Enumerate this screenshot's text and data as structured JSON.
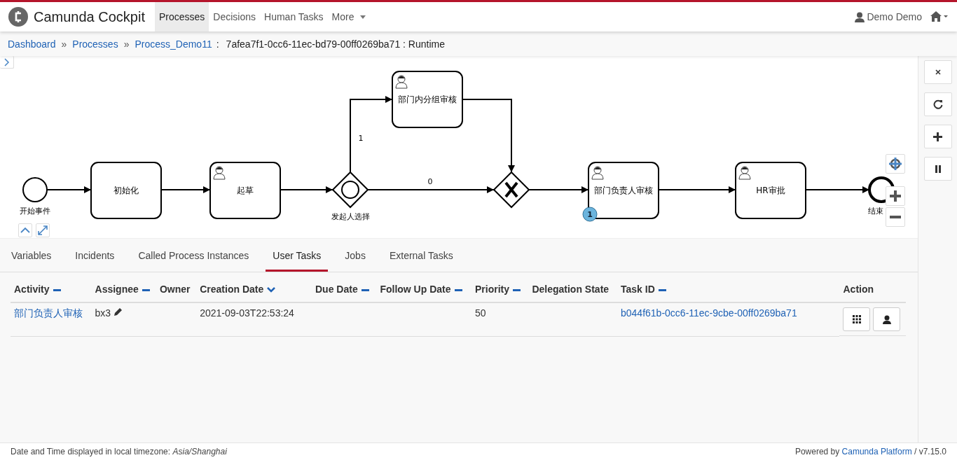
{
  "header": {
    "brand": "Camunda Cockpit",
    "nav": [
      {
        "label": "Processes",
        "selected": true,
        "dropdown": false
      },
      {
        "label": "Decisions",
        "selected": false,
        "dropdown": false
      },
      {
        "label": "Human Tasks",
        "selected": false,
        "dropdown": false
      },
      {
        "label": "More",
        "selected": false,
        "dropdown": true
      }
    ],
    "user": "Demo Demo"
  },
  "breadcrumb": {
    "links": [
      "Dashboard",
      "Processes",
      "Process_Demo11"
    ],
    "separator": "»",
    "current_separator": ":",
    "current": "7afea7f1-0cc6-11ec-bd79-00ff0269ba71 : Runtime"
  },
  "diagram": {
    "nodes": [
      {
        "kind": "start",
        "label": "开始事件"
      },
      {
        "kind": "task",
        "label": "初始化"
      },
      {
        "kind": "user_task",
        "label": "起草"
      },
      {
        "kind": "event_gateway",
        "label": "发起人选择"
      },
      {
        "kind": "user_task",
        "label": "部门内分组审核"
      },
      {
        "kind": "xor_gateway"
      },
      {
        "kind": "user_task",
        "label": "部门负责人审核",
        "badge": "1"
      },
      {
        "kind": "user_task",
        "label": "HR审批"
      },
      {
        "kind": "end",
        "label": "结束"
      }
    ],
    "flow_labels": [
      "1",
      "0"
    ]
  },
  "tabs": [
    {
      "label": "Variables",
      "selected": false
    },
    {
      "label": "Incidents",
      "selected": false
    },
    {
      "label": "Called Process Instances",
      "selected": false
    },
    {
      "label": "User Tasks",
      "selected": true
    },
    {
      "label": "Jobs",
      "selected": false
    },
    {
      "label": "External Tasks",
      "selected": false
    }
  ],
  "table": {
    "columns": [
      {
        "label": "Activity",
        "sortable": true,
        "sorted": false
      },
      {
        "label": "Assignee",
        "sortable": true,
        "sorted": false
      },
      {
        "label": "Owner",
        "sortable": false
      },
      {
        "label": "Creation Date",
        "sortable": true,
        "sorted": true
      },
      {
        "label": "Due Date",
        "sortable": true,
        "sorted": false
      },
      {
        "label": "Follow Up Date",
        "sortable": true,
        "sorted": false
      },
      {
        "label": "Priority",
        "sortable": true,
        "sorted": false
      },
      {
        "label": "Delegation State",
        "sortable": false
      },
      {
        "label": "Task ID",
        "sortable": true,
        "sorted": false
      },
      {
        "label": "Action",
        "sortable": false
      }
    ],
    "rows": [
      {
        "activity": "部门负责人审核",
        "assignee": "bx3",
        "creation_date": "2021-09-03T22:53:24",
        "priority": "50",
        "task_id": "b044f61b-0cc6-11ec-9cbe-00ff0269ba71"
      }
    ]
  },
  "footer": {
    "timezone": "Date and Time displayed in local timezone: *Asia/Shanghai*",
    "powered_by": "Powered by",
    "platform": "Camunda Platform",
    "version": "/ v7.15.0"
  }
}
